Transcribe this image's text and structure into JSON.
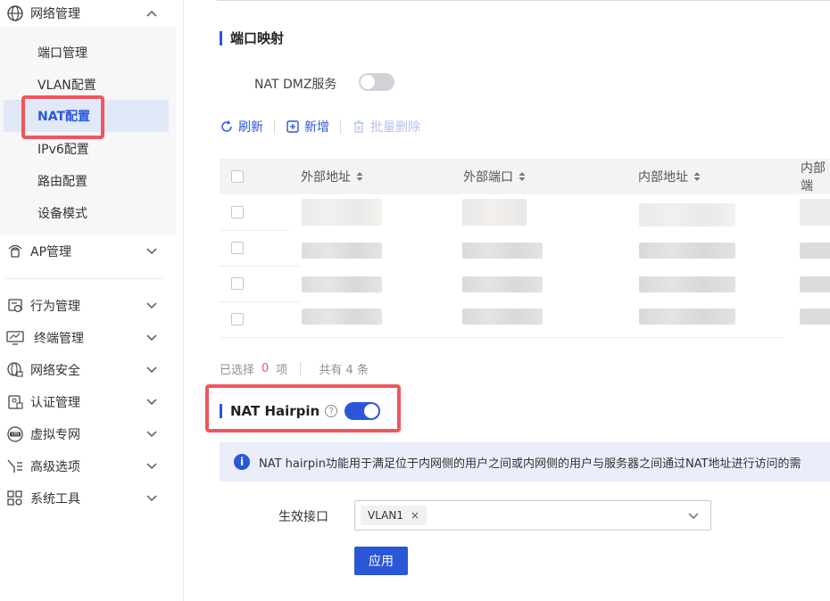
{
  "sidebar": {
    "network_group": {
      "label": "网络管理",
      "icon": "globe-icon",
      "expanded": true
    },
    "sub_items": [
      {
        "label": "端口管理",
        "active": false
      },
      {
        "label": "VLAN配置",
        "active": false
      },
      {
        "label": "NAT配置",
        "active": true
      },
      {
        "label": "IPv6配置",
        "active": false
      },
      {
        "label": "路由配置",
        "active": false
      },
      {
        "label": "设备模式",
        "active": false
      }
    ],
    "groups": [
      {
        "label": "AP管理",
        "icon": "ap-icon"
      },
      {
        "label": "行为管理",
        "icon": "behavior-icon"
      },
      {
        "label": "终端管理",
        "icon": "monitor-icon"
      },
      {
        "label": "网络安全",
        "icon": "globe-lock-icon"
      },
      {
        "label": "认证管理",
        "icon": "auth-icon"
      },
      {
        "label": "虚拟专网",
        "icon": "vpn-icon"
      },
      {
        "label": "高级选项",
        "icon": "advanced-icon"
      },
      {
        "label": "系统工具",
        "icon": "tools-icon"
      }
    ]
  },
  "port_mapping": {
    "title": "端口映射",
    "dmz_label": "NAT DMZ服务",
    "dmz_enabled": false,
    "toolbar": {
      "refresh": "刷新",
      "add": "新增",
      "batch_delete": "批量删除"
    },
    "columns": [
      "外部地址",
      "外部端口",
      "内部地址",
      "内部端"
    ],
    "row_count": 4,
    "footer": {
      "selected_prefix": "已选择",
      "selected_count": "0",
      "selected_suffix": "项",
      "total": "共有 4 条"
    }
  },
  "hairpin": {
    "title": "NAT Hairpin",
    "enabled": true,
    "info_text": "NAT hairpin功能用于满足位于内网侧的用户之间或内网侧的用户与服务器之间通过NAT地址进行访问的需",
    "field_label": "生效接口",
    "selected_tag": "VLAN1",
    "apply_label": "应用"
  },
  "colors": {
    "accent": "#2a57d8",
    "highlight_box": "#f0565b",
    "active_bg": "#e1e8f8"
  }
}
